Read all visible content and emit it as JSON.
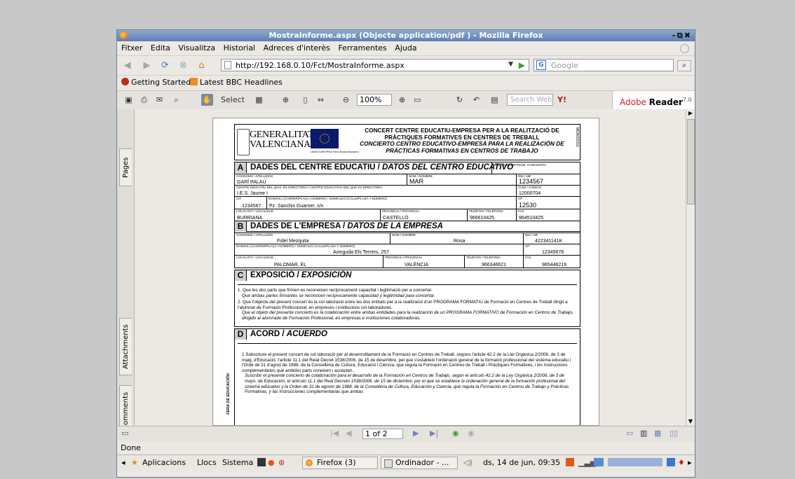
{
  "window": {
    "title": "MostraInforme.aspx (Objecte application/pdf ) - Mozilla Firefox"
  },
  "menu": [
    "Fitxer",
    "Edita",
    "Visualitza",
    "Historial",
    "Adreces d'interès",
    "Ferramentes",
    "Ajuda"
  ],
  "nav": {
    "url": "http://192.168.0.10/Fct/MostraInforme.aspx",
    "search_placeholder": "Google",
    "search_engine": "G"
  },
  "bookmarks": [
    {
      "label": "Getting Started"
    },
    {
      "label": "Latest BBC Headlines"
    }
  ],
  "acrobat": {
    "select_label": "Select",
    "zoom": "100%",
    "search_web": "Search Web",
    "brand": "Adobe",
    "product": "Reader",
    "version": "7.0"
  },
  "side_tabs": [
    "Pages",
    "Attachments",
    "Comments"
  ],
  "doc": {
    "logo_line1": "GENERALITAT",
    "logo_line2": "VALENCIANA",
    "eu_text": "UNIÓ EUROPEA Fons Social Europeu",
    "header_line1": "CONCERT CENTRE EDUCATIU-EMPRESA PER A LA REALITZACIÓ DE",
    "header_line2": "PRÀCTIQUES FORMATIVES EN CENTRES DE TREBALL",
    "header_line3": "CONCIERTO CENTRO EDUCATIVO-EMPRESA PARA LA REALIZACIÓN DE",
    "header_line4": "PRÁCTICAS FORMATIVAS EN CENTROS DE TRABAJO",
    "doc_code": "MDA000216",
    "secA": {
      "letter": "A",
      "title": "DADES DEL CENTRE EDUCATIU /",
      "title_it": "DATOS DEL CENTRO EDUCATIVO",
      "concert_label": "NÚM. CONCERT/NÚM. CONCIERTO",
      "cognoms_label": "COGNOMS / APELLIDOS",
      "cognoms": "GARÍ PALAU",
      "nom_label": "NOM / NOMBRE",
      "nom": "MAR",
      "dni_label": "DNI / NIF",
      "dni": "1234567",
      "centre_label": "CENTRE EDUCATIU DEL QUAL ÉS DIRECTOR/A / CENTRO EDUCATIVO DEL QUE ES DIRECTOR/A",
      "centre": "I.E.S. Jaume I",
      "codi_label": "CODI / CÓDIGO",
      "codi": "12000704",
      "cif_label": "CIF",
      "cif": "1234567",
      "domicili_label": "DOMICILI (CARRER/PLAÇA I NÚMERO) / DOMICILIO (CALLE/PLAZA Y NÚMERO)",
      "domicili": "Pz. Sanchis Guarner, s/n",
      "cp_label": "CP",
      "cp": "12530",
      "loc_label": "LOCALITAT / LOCALIDAD",
      "loc": "BURRIANA",
      "prov_label": "PROVÍNCIA / PROVINCIA",
      "prov": "CASTELLÓ",
      "tel_label": "TELÈFON / TELÉFONO",
      "tel": "966610425",
      "fax_label": "FAX",
      "fax": "964510425"
    },
    "secB": {
      "letter": "B",
      "title": "DADES DE L'EMPRESA /",
      "title_it": "DATOS DE LA EMPRESA",
      "cognoms_label": "COGNOMS / APELLIDOS",
      "cognoms": "Fidel Mezquita",
      "nom_label": "NOM / NOMBRE",
      "nom": "Rosa",
      "dni_label": "DNI / NIF",
      "dni": "422341141K",
      "domicili_label": "DOMICILI (CARRER/PLAÇA I NÚMERO) / DOMICILIO (CALLE/PLAZA Y NÚMERO)",
      "domicili": "Avinguda Els Terrers, 257",
      "cp_label": "CP",
      "cp": "12345678",
      "loc_label": "LOCALITAT / LOCALIDAD",
      "loc": "PALOMAR, EL",
      "prov_label": "PROVÍNCIA / PROVINCIA",
      "prov": "VALÈNCIA",
      "tel_label": "TELÈFON / TELÉFONO",
      "tel": "966346621",
      "fax_label": "FAX",
      "fax": "965446219"
    },
    "secC": {
      "letter": "C",
      "title": "EXPOSICIÓ /",
      "title_it": "EXPOSICIÓN",
      "p1": "1. Que les dos parts que firmen es reconeixen recíprocament capacitat i legitimació per a concertar.",
      "p1_it": "Que ambas partes firmantes se reconocen recíprocamente capacidad y legitimidad para concertar.",
      "p2": "2. Que l'objecte del present concert és la col·laboració entre les dos entitats per a la realització d'un PROGRAMA FORMATIU de Formació en Centres de Treball dirigit a l'alumnat de Formació Professional, en empreses i institucions col·laboradores.",
      "p2_it": "Que el objeto del presente concierto es la colaboración entre ambas entidades para la realización de un PROGRAMA FORMATIVO de Formación en Centros de Trabajo, dirigido al alumnado de Formación Profesional, en empresas e instituciones colaboradoras."
    },
    "secD": {
      "letter": "D",
      "title": "ACORD /",
      "title_it": "ACUERDO",
      "side": "FERA DE EDUCACIÓN",
      "p1": "1 Subscriure el present concert de col·laboració per al desenrotllament de la Formació en Centres de Treball, segons l'article 42.2 de la Llei Orgànica 2/2006, de 3 de maig, d'Educació, l'article 11.1 del Reial Decret 1538/2006, de 15 de desembre, pel que s'estableix l'ordenació general de la formació professional del sistema educatiu i l'Orde de 31 d'agost de 1988, de la Conselleria de Cultura, Educació i Ciència, que regula la Formació en Centres de Treball i Pràctiques Formatives, i les Instruccions complementàries que ambdós parts coneixen i accepten.",
      "p1_it": "Suscribir el presente concierto de colaboración para el desarrollo de la Formación en Centros de Trabajo, según el artículo 42.2 de la Ley Orgánica 2/2006, de 3 de mayo, de Educación, el artículo 11.1 del Real Decreto 1538/2006, de 15 de diciembre, por el que se establece la ordenación general de la formación profesional del sistema educativo y la Orden de 31 de agosto de 1988, de la Conselleria de Cultura, Educación y Ciencia, que regula la Formación en Centros de Trabajo y Prácticas Formativas, y las Instrucciones complementarias que ambas"
    }
  },
  "pagination": {
    "current": "1 of 2"
  },
  "status": "Done",
  "taskbar": {
    "apps": "Aplicacions",
    "places": "Llocs",
    "system": "Sistema",
    "firefox": "Firefox (3)",
    "ordinador": "Ordinador - ...",
    "datetime": "ds, 14 de jun, 09:35"
  }
}
